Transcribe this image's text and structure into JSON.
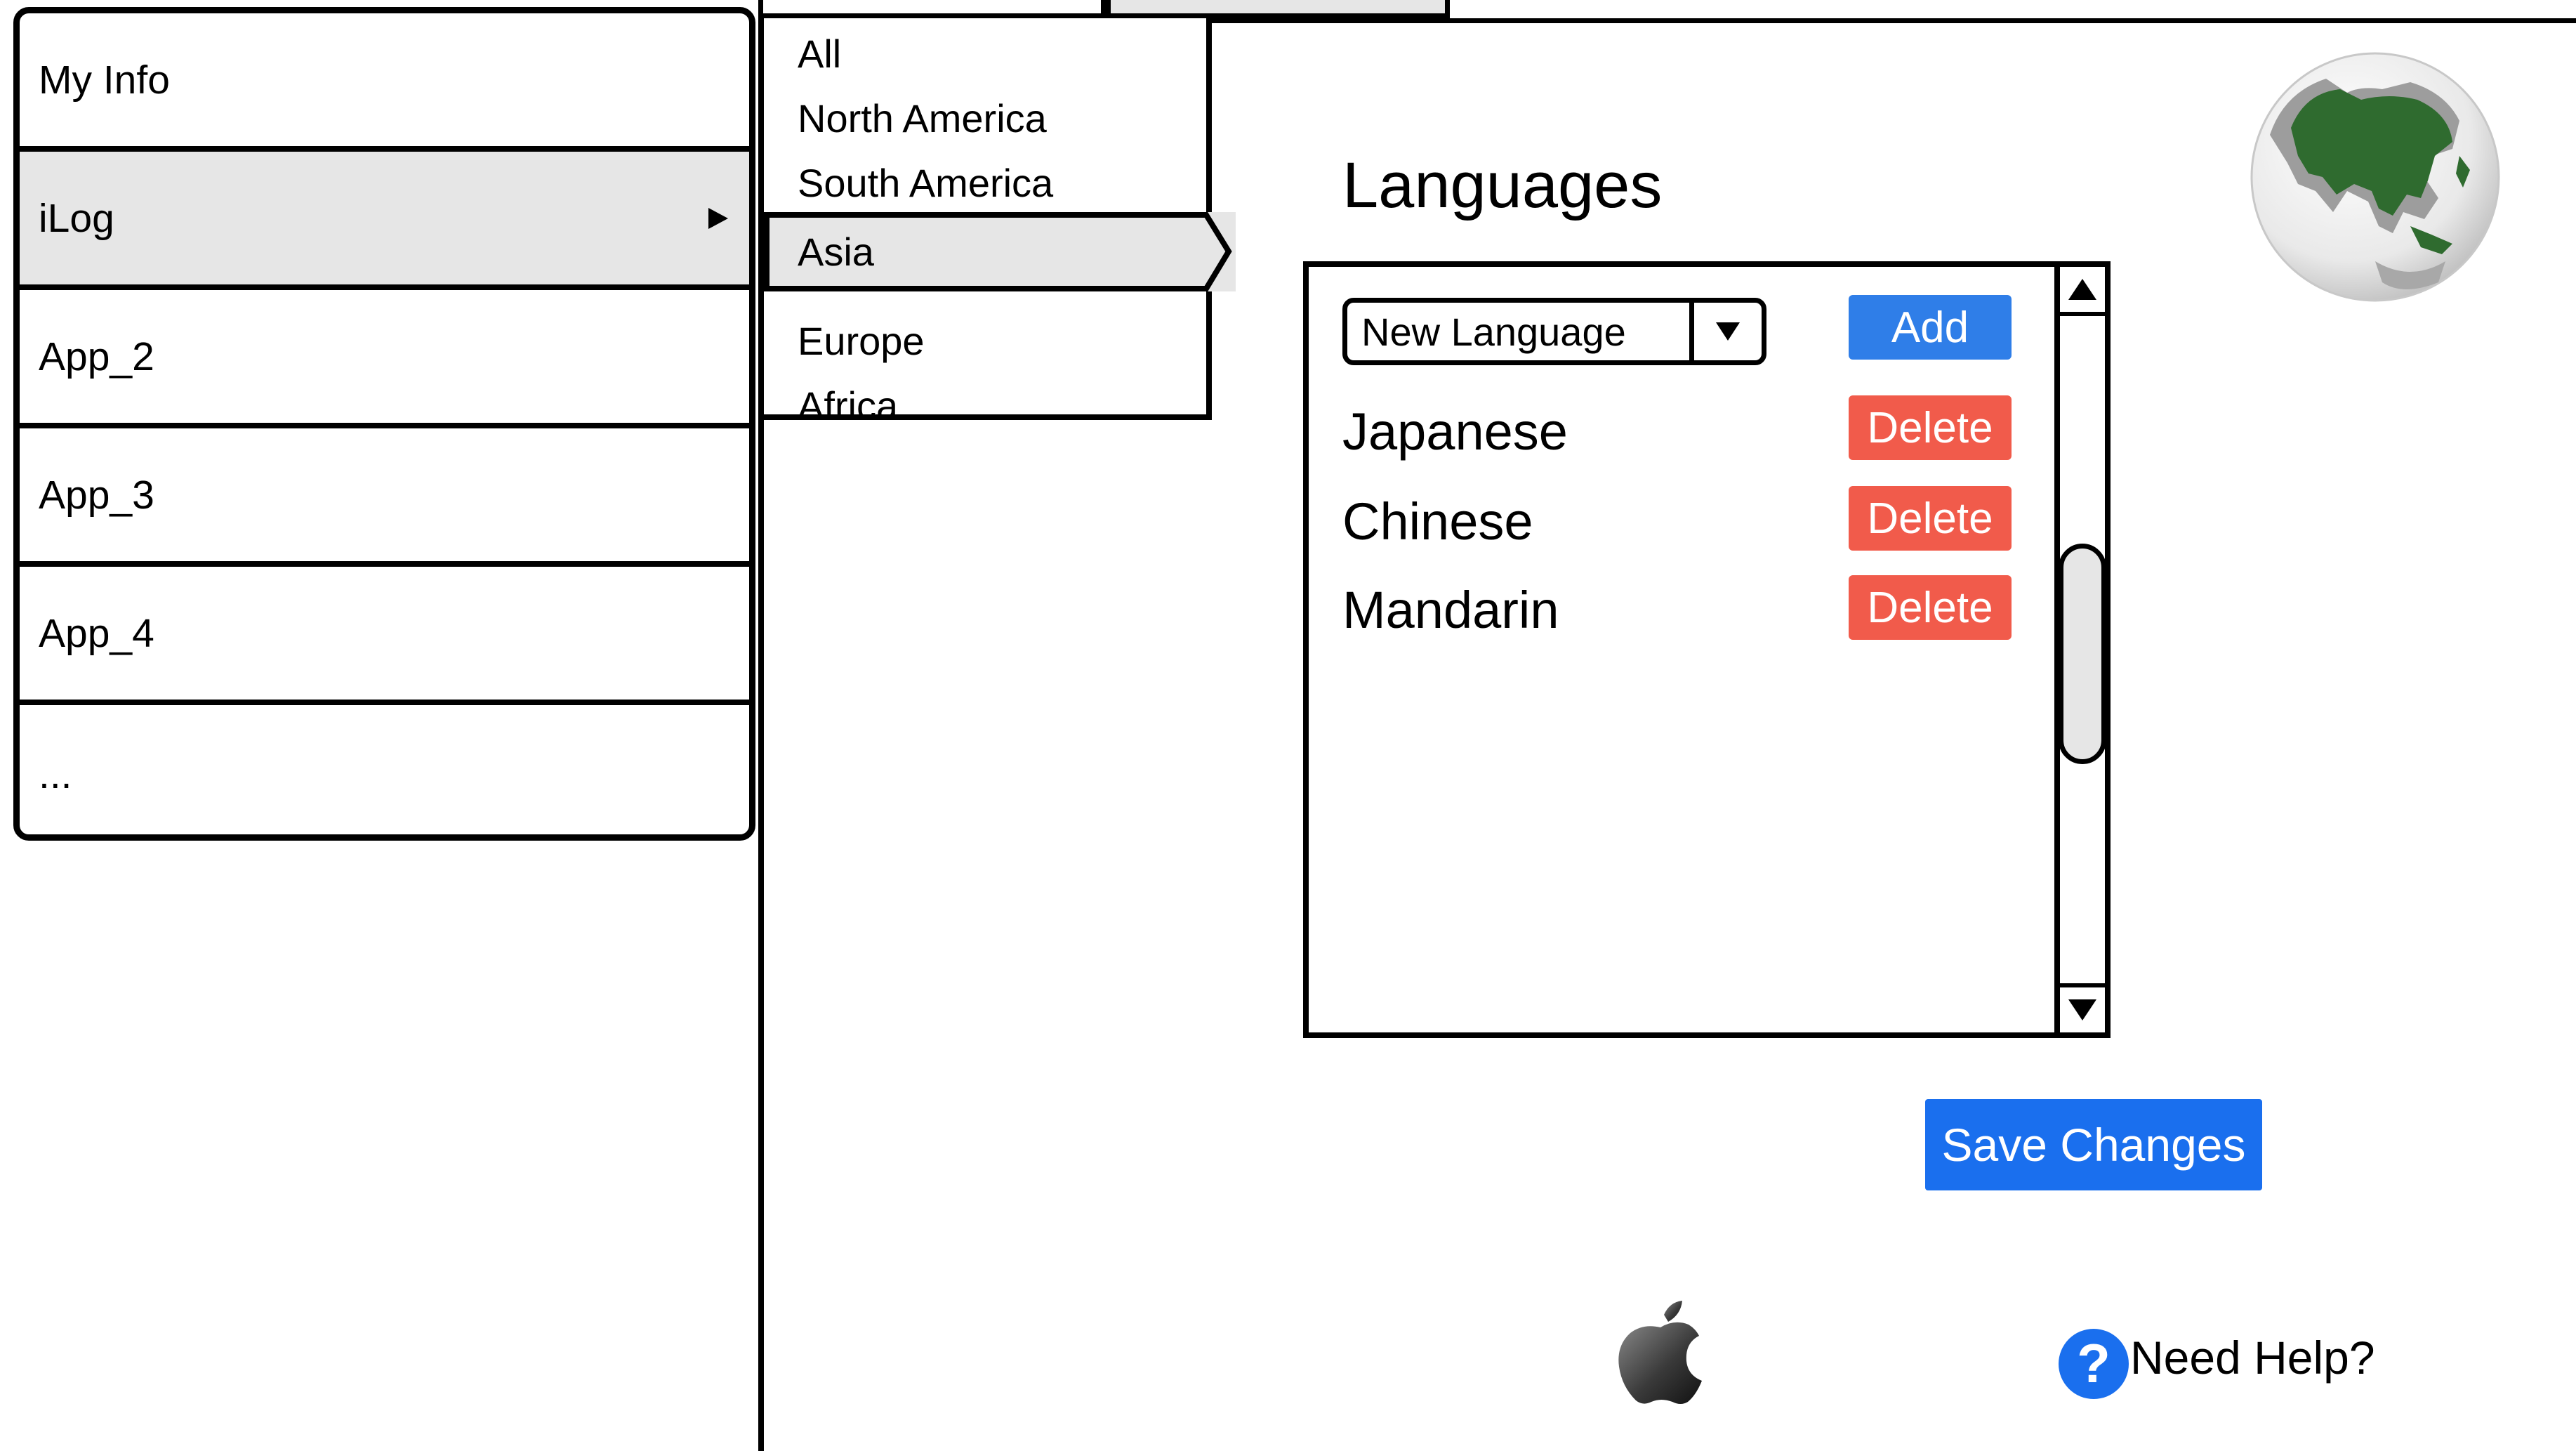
{
  "sidebar": {
    "items": [
      {
        "label": "My Info"
      },
      {
        "label": "iLog"
      },
      {
        "label": "App_2"
      },
      {
        "label": "App_3"
      },
      {
        "label": "App_4"
      },
      {
        "label": "..."
      }
    ],
    "active_item": "iLog"
  },
  "region_menu": {
    "items": [
      {
        "label": "All"
      },
      {
        "label": "North America"
      },
      {
        "label": "South America"
      },
      {
        "label": "Asia"
      },
      {
        "label": "Europe"
      },
      {
        "label": "Africa"
      }
    ],
    "selected": "Asia"
  },
  "languages": {
    "title": "Languages",
    "new_language_select": {
      "value": "New Language"
    },
    "add_label": "Add",
    "list": [
      {
        "name": "Japanese",
        "delete_label": "Delete"
      },
      {
        "name": "Chinese",
        "delete_label": "Delete"
      },
      {
        "name": "Mandarin",
        "delete_label": "Delete"
      }
    ]
  },
  "save_label": "Save Changes",
  "help_label": "Need Help?",
  "icons": {
    "globe": "globe-asia-icon",
    "apple": "apple-logo-icon",
    "help": "question-mark-icon",
    "submenu": "chevron-right-icon"
  },
  "colors": {
    "add_button": "#2f7ee8",
    "delete_button": "#f15b4b",
    "save_button": "#1a6fee",
    "highlight": "#e6e6e6",
    "globe_land": "#2f6b2f"
  }
}
